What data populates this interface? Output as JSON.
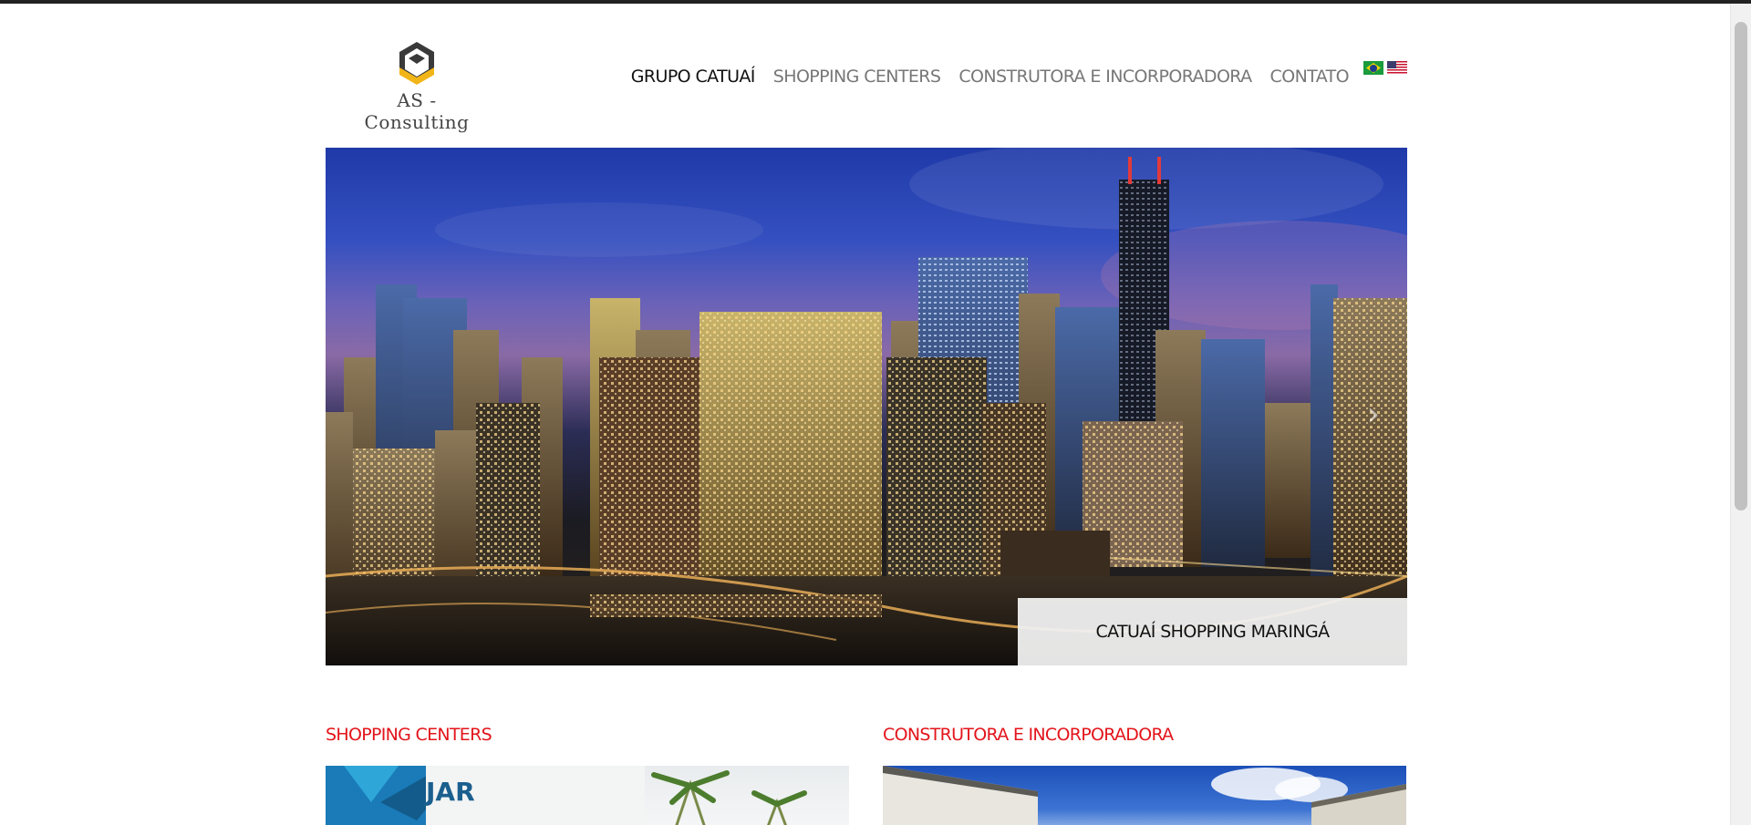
{
  "header": {
    "logo_text": "AS - Consulting",
    "nav": [
      {
        "label": "GRUPO CATUAÍ",
        "active": true
      },
      {
        "label": "SHOPPING CENTERS",
        "active": false
      },
      {
        "label": "CONSTRUTORA E INCORPORADORA",
        "active": false
      },
      {
        "label": "CONTATO",
        "active": false
      }
    ],
    "flags": [
      "brazil-flag-icon",
      "usa-flag-icon"
    ]
  },
  "slider": {
    "caption": "CATUAÍ SHOPPING MARINGÁ",
    "next_icon": "chevron-right-icon"
  },
  "sections": {
    "left_title": "SHOPPING CENTERS",
    "right_title": "CONSTRUTORA E INCORPORADORA"
  },
  "colors": {
    "accent_red": "#e3141b",
    "logo_orange": "#f2b518",
    "logo_dark": "#3a3a3a"
  }
}
